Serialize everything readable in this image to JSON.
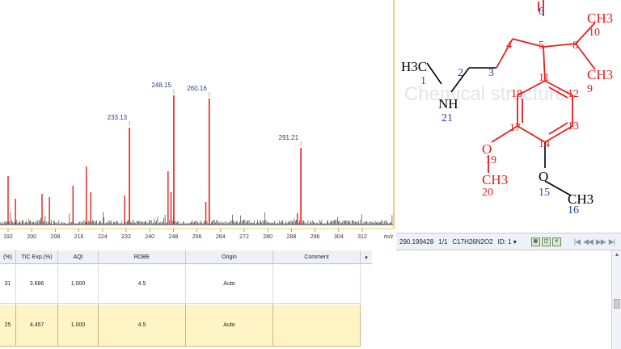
{
  "spectrum": {
    "x_axis_labels": [
      "192",
      "200",
      "208",
      "216",
      "224",
      "232",
      "240",
      "248",
      "256",
      "264",
      "272",
      "280",
      "288",
      "296",
      "304",
      "312"
    ],
    "x_unit": "m/z",
    "peak_labels": [
      {
        "text": "248.15",
        "mz": 248.15
      },
      {
        "text": "260.16",
        "mz": 260.16
      },
      {
        "text": "233.13",
        "mz": 233.13
      },
      {
        "text": "291.21",
        "mz": 291.21
      }
    ],
    "peak_color": "#e0201e"
  },
  "structure": {
    "watermark": "Chemical structures",
    "atoms": [
      {
        "label": "6",
        "color": "#3040a0"
      },
      {
        "label": "5",
        "color": "#e0201e"
      },
      {
        "label": "4",
        "color": "#e0201e"
      },
      {
        "label": "8",
        "color": "#e0201e"
      },
      {
        "label": "10",
        "color": "#e0201e"
      },
      {
        "label": "9",
        "color": "#e0201e"
      },
      {
        "label": "3",
        "color": "#3040a0"
      },
      {
        "label": "2",
        "color": "#3040a0"
      },
      {
        "label": "1",
        "color": "#3040a0"
      },
      {
        "label": "11",
        "color": "#e0201e"
      },
      {
        "label": "12",
        "color": "#e0201e"
      },
      {
        "label": "13",
        "color": "#e0201e"
      },
      {
        "label": "14",
        "color": "#e0201e"
      },
      {
        "label": "17",
        "color": "#e0201e"
      },
      {
        "label": "18",
        "color": "#e0201e"
      },
      {
        "label": "19",
        "color": "#e0201e"
      },
      {
        "label": "20",
        "color": "#e0201e"
      },
      {
        "label": "15",
        "color": "#3040a0"
      },
      {
        "label": "16",
        "color": "#3040a0"
      },
      {
        "label": "21",
        "color": "#3040a0"
      }
    ],
    "groups": {
      "ch3_top": "CH3",
      "ch3_mid": "CH3",
      "h3c": "H3C",
      "nh": "NH",
      "o_left": "O",
      "ch3_left": "CH3",
      "o_right": "O",
      "ch3_right": "CH3"
    }
  },
  "toolbar": {
    "mass": "290.199428",
    "page": "1/1",
    "formula": "C17H26N2O2",
    "id_label": "ID: 1",
    "dropdown_glyph": "▾"
  },
  "table": {
    "columns": [
      {
        "label": "(%)"
      },
      {
        "label": "TIC Exp.(%)"
      },
      {
        "label": "AQI"
      },
      {
        "label": "RDBE"
      },
      {
        "label": "Origin"
      },
      {
        "label": "Comment"
      },
      {
        "label": "▾"
      }
    ],
    "rows": [
      {
        "c0": "31",
        "c1": "3.686",
        "c2": "1.000",
        "c3": "4.5",
        "c4": "Auto",
        "c5": ""
      },
      {
        "c0": "25",
        "c1": "4.457",
        "c2": "1.000",
        "c3": "4.5",
        "c4": "Auto",
        "c5": ""
      }
    ]
  }
}
